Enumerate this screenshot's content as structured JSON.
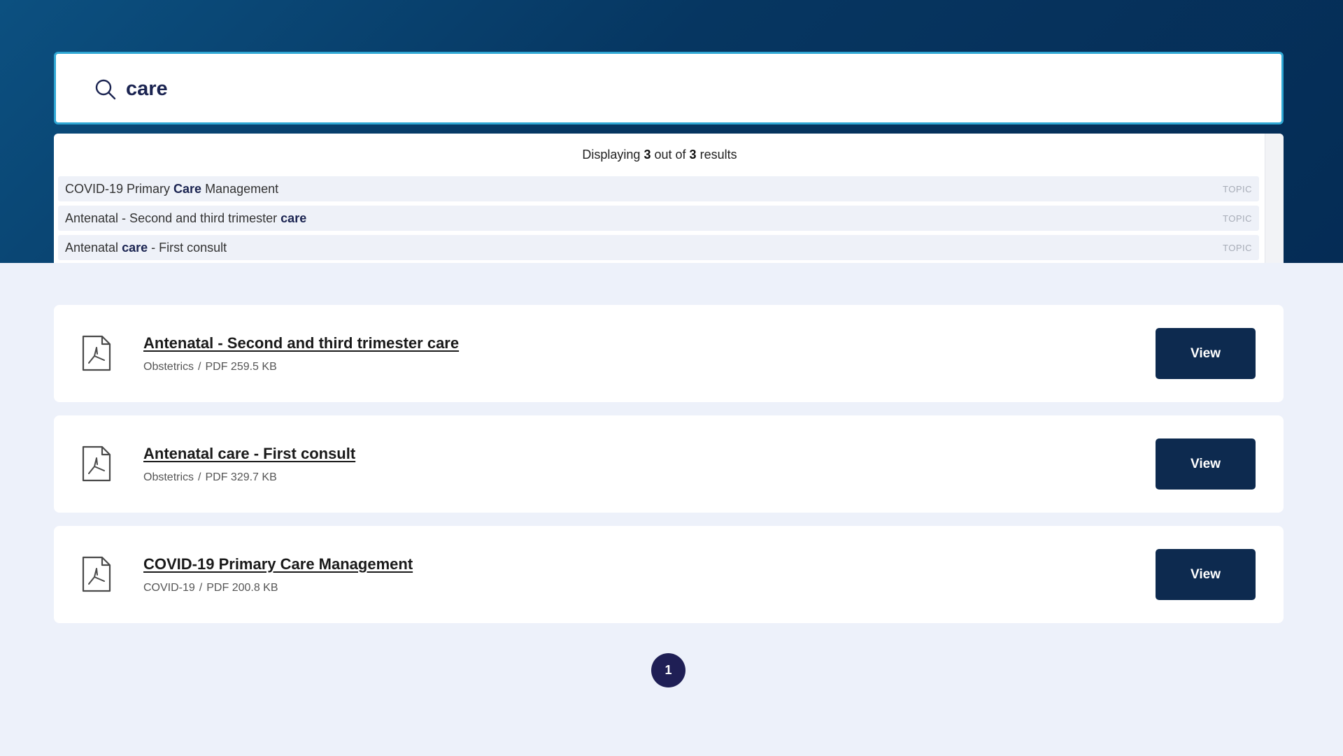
{
  "search": {
    "value": "care"
  },
  "dropdown": {
    "count_prefix": "Displaying",
    "count_shown": "3",
    "count_middle": "out of",
    "count_total": "3",
    "count_suffix": "results",
    "suggestions": [
      {
        "before": "COVID-19 Primary ",
        "match": "Care",
        "after": " Management",
        "tag": "TOPIC"
      },
      {
        "before": "Antenatal - Second and third trimester ",
        "match": "care",
        "after": "",
        "tag": "TOPIC"
      },
      {
        "before": "Antenatal ",
        "match": "care",
        "after": " - First consult",
        "tag": "TOPIC"
      }
    ]
  },
  "results": [
    {
      "title": "Antenatal - Second and third trimester care",
      "category": "Obstetrics",
      "separator": "/",
      "file_info": "PDF 259.5 KB",
      "button": "View",
      "icon": "pdf-file-icon"
    },
    {
      "title": "Antenatal care - First consult",
      "category": "Obstetrics",
      "separator": "/",
      "file_info": "PDF 329.7 KB",
      "button": "View",
      "icon": "pdf-file-icon"
    },
    {
      "title": "COVID-19 Primary Care Management",
      "category": "COVID-19",
      "separator": "/",
      "file_info": "PDF 200.8 KB",
      "button": "View",
      "icon": "pdf-file-icon"
    }
  ],
  "pagination": {
    "current": "1"
  },
  "colors": {
    "accent": "#2fa7d4",
    "button": "#0d2a4f",
    "page_active": "#1f1f55",
    "hero": "#063661",
    "background": "#edf1fa"
  }
}
